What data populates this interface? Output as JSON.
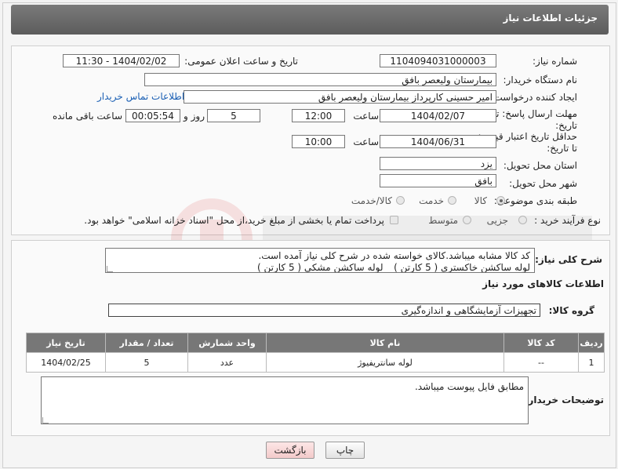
{
  "header": {
    "title": "جزئیات اطلاعات نیاز"
  },
  "form": {
    "need_number": {
      "label": "شماره نیاز:",
      "value": "1104094031000003"
    },
    "announce_datetime": {
      "label": "تاریخ و ساعت اعلان عمومی:",
      "value": "1404/02/02 - 11:30"
    },
    "buyer_org": {
      "label": "نام دستگاه خریدار:",
      "value": "بیمارستان ولیعصر بافق"
    },
    "requester": {
      "label": "ایجاد کننده درخواست:",
      "value": "امیر حسینی کارپرداز بیمارستان ولیعصر بافق",
      "contact_link": "اطلاعات تماس خریدار"
    },
    "reply_deadline": {
      "label_line1": "مهلت ارسال پاسخ: تا",
      "label_line2": "تاریخ:",
      "date": "1404/02/07",
      "time_label": "ساعت",
      "time": "12:00",
      "days": "5",
      "days_label": "روز و",
      "remaining": "00:05:54",
      "remaining_label": "ساعت باقی مانده"
    },
    "price_validity": {
      "label_line1": "حداقل تاریخ اعتبار قیمت:",
      "label_line2": "تا تاریخ:",
      "date": "1404/06/31",
      "time_label": "ساعت",
      "time": "10:00"
    },
    "delivery_province": {
      "label": "استان محل تحویل:",
      "value": "یزد"
    },
    "delivery_city": {
      "label": "شهر محل تحویل:",
      "value": "بافق"
    },
    "category": {
      "label": "طبقه بندی موضوعی:",
      "options": [
        "کالا",
        "خدمت",
        "کالا/خدمت"
      ],
      "selected": "کالا"
    },
    "process_type": {
      "label": "نوع فرآیند خرید :",
      "options": [
        "جزیی",
        "متوسط"
      ],
      "payment_note": "پرداخت تمام یا بخشی از مبلغ خرید،از محل \"اسناد خزانه اسلامی\" خواهد بود."
    }
  },
  "summary": {
    "label": "شرح کلی نیاز:",
    "line1": "کد کالا مشابه میباشد.کالای خواسته شده در شرح کلی نیاز آمده است.",
    "line2": "لوله ساکشن خاکستری ( 5 کارتن ) _ لوله ساکشن مشکی ( 5 کارتن )"
  },
  "goods": {
    "section_title": "اطلاعات کالاهای مورد نیاز",
    "group_label": "گروه کالا:",
    "group_value": "تجهیزات آزمایشگاهی و اندازه‌گیری",
    "columns": [
      "ردیف",
      "کد کالا",
      "نام کالا",
      "واحد شمارش",
      "تعداد / مقدار",
      "تاریخ نیاز"
    ],
    "rows": [
      [
        "1",
        "--",
        "لوله سانتریفیوژ",
        "عدد",
        "5",
        "1404/02/25"
      ]
    ]
  },
  "buyer_notes": {
    "label": "توضیحات خریدار:",
    "value": "مطابق فایل پیوست میباشد."
  },
  "buttons": {
    "print": "چاپ",
    "back": "بازگشت"
  },
  "colors": {
    "header_bg": "#6b6b6b",
    "link": "#1a5fb4",
    "back_button": "#f3caca"
  }
}
